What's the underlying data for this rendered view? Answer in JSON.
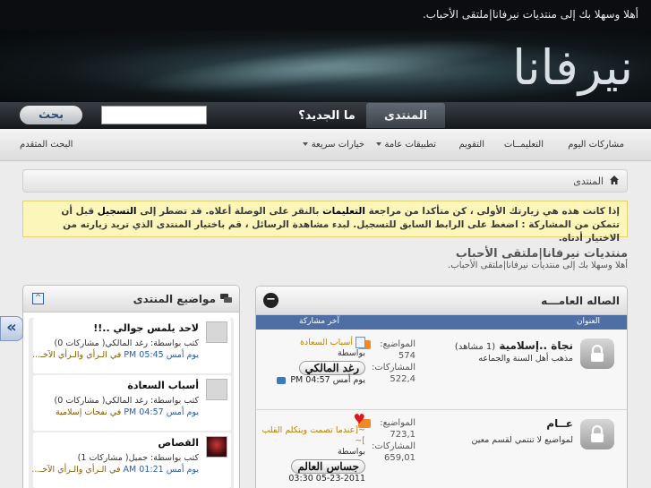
{
  "topbar": {
    "welcome": "أهلا وسهلا بك إلى منتديات نيرفانا|ملتقى الأحباب."
  },
  "banner": {
    "logo_text": "نيرفانا"
  },
  "nav": {
    "tab_forum": "المنتدى",
    "tab_new": "ما الجديد؟"
  },
  "search": {
    "button": "بحث",
    "placeholder": ""
  },
  "subnav": {
    "items": [
      "مشاركات اليوم",
      "التعليمــات",
      "التقويم",
      "تطبيقات عامة",
      "خيارات سريعة"
    ],
    "advanced": "البحث المتقدم"
  },
  "breadcrumb": {
    "home": "المنتدى"
  },
  "notice": {
    "p1": "إذا كانت هذه هي زيارتك الأولى ، كن متأكدا من مراجعة",
    "faq": "التعليمات",
    "p2": "بالنقر على الوصلة أعلاه. قد تضطر إلى",
    "register": "التسجيل",
    "p3": "قبل أن تتمكن من المشاركة : اضغط على الرابط السابق للتسجيل. لبدء مشاهدة الرسائل ، قم باختيار المنتدى الذي تريد زيارته من الاختيار أدناه."
  },
  "forum": {
    "title": "منتديات نيرفانا|ملتقى الأحباب",
    "desc": "أهلا وسهلا بك إلى منتديات نيرفانا|ملتقى الأحباب."
  },
  "category": {
    "title": "الصاله العامـــه",
    "collapse": "−",
    "col_title": "العنوان",
    "col_last": "آخر مشاركة",
    "forums": [
      {
        "name": "نجاة ..إسلامية",
        "viewers": "(1 مشاهد)",
        "desc": "مذهب أهل السنة والجماعه",
        "threads_label": "المواضيع:",
        "threads": "574",
        "posts_label": "المشاركات:",
        "posts": "522,4",
        "last_title": "أسباب السعادة",
        "by_label": "بواسطة",
        "author": "رغد المالكي",
        "date": "يوم أمس 04:57 PM"
      },
      {
        "name": "عــام",
        "viewers": "",
        "desc": "لمواضيع لا تنتمي لقسم معين",
        "threads_label": "المواضيع:",
        "threads": "723,1",
        "posts_label": "المشاركات:",
        "posts": "659,01",
        "last_title": "~[عندما تصمت ويتكلم القلب ]~",
        "by_label": "بواسطة",
        "author": "جساس العالم",
        "date": "05-23-2011 03:30"
      }
    ]
  },
  "sidebar": {
    "title": "مواضيع المنتدى",
    "toggle": "^",
    "posts": [
      {
        "title": "لاحد يلمس جوالي ..!!",
        "line1": "كتب بواسطة: رغد المالكي( مشاركات 0)",
        "line2_time": "يوم أمس 05:45 PM",
        "line2_link": "في الـرأي والـرأي الآخـ..."
      },
      {
        "title": "أسباب السعادة",
        "line1": "كتب بواسطة: رغد المالكي( مشاركات 0)",
        "line2_time": "يوم أمس 04:57 PM",
        "line2_link": "في نفحات إسلامية"
      },
      {
        "title": "القصاص",
        "line1": "كتب بواسطة: جميل( مشاركات 1)",
        "line2_time": "يوم أمس 01:21 AM",
        "line2_link": "في الـرأي والـرأي الآخـ..."
      }
    ]
  },
  "side_arrow": "«",
  "colors": {
    "accent": "#4e6fa6",
    "notice_bg": "#fdf6bb",
    "link_gold": "#b5830b"
  }
}
